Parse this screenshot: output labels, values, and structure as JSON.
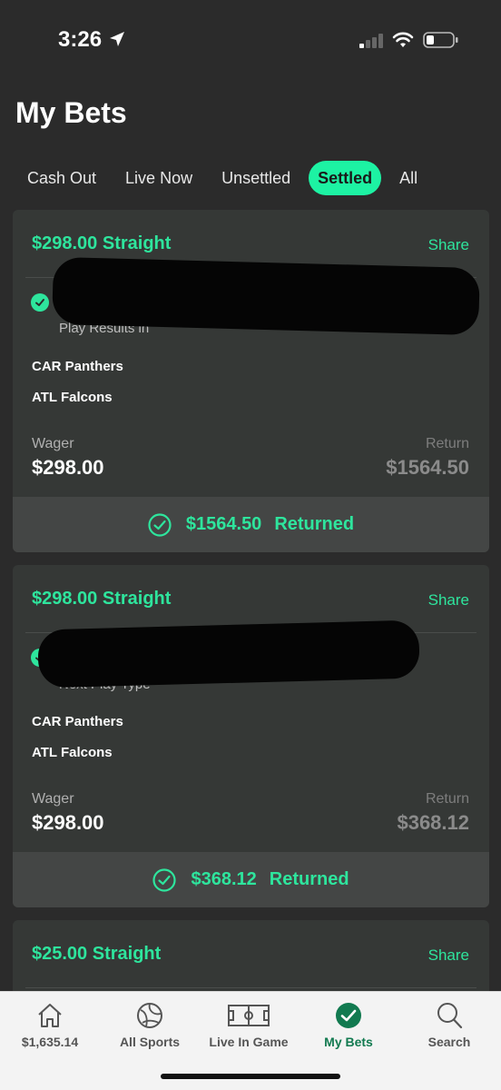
{
  "status_bar": {
    "time": "3:26"
  },
  "page": {
    "title": "My Bets"
  },
  "tabs": [
    {
      "label": "Cash Out",
      "active": false
    },
    {
      "label": "Live Now",
      "active": false
    },
    {
      "label": "Unsettled",
      "active": false
    },
    {
      "label": "Settled",
      "active": true
    },
    {
      "label": "All",
      "active": false
    }
  ],
  "cards": [
    {
      "title": "$298.00 Straight",
      "share_label": "Share",
      "subtext": "Play Results in",
      "teams": [
        "CAR Panthers",
        "ATL Falcons"
      ],
      "wager_label": "Wager",
      "wager_value": "$298.00",
      "return_label": "Return",
      "return_value": "$1564.50",
      "returned_amount": "$1564.50",
      "returned_word": "Returned"
    },
    {
      "title": "$298.00 Straight",
      "share_label": "Share",
      "subtext": "Next Play Type",
      "teams": [
        "CAR Panthers",
        "ATL Falcons"
      ],
      "wager_label": "Wager",
      "wager_value": "$298.00",
      "return_label": "Return",
      "return_value": "$368.12",
      "returned_amount": "$368.12",
      "returned_word": "Returned"
    },
    {
      "title": "$25.00 Straight",
      "share_label": "Share"
    }
  ],
  "bottom_nav": [
    {
      "label": "$1,635.14",
      "icon": "home-icon",
      "active": false
    },
    {
      "label": "All Sports",
      "icon": "ball-icon",
      "active": false
    },
    {
      "label": "Live In Game",
      "icon": "field-icon",
      "active": false
    },
    {
      "label": "My Bets",
      "icon": "check-circle-icon",
      "active": true
    },
    {
      "label": "Search",
      "icon": "search-icon",
      "active": false
    }
  ],
  "colors": {
    "accent": "#2ee59d",
    "tab_active_bg": "#1df2a3",
    "background": "#2b2b2b",
    "card": "#353836",
    "nav_active": "#127a50"
  }
}
